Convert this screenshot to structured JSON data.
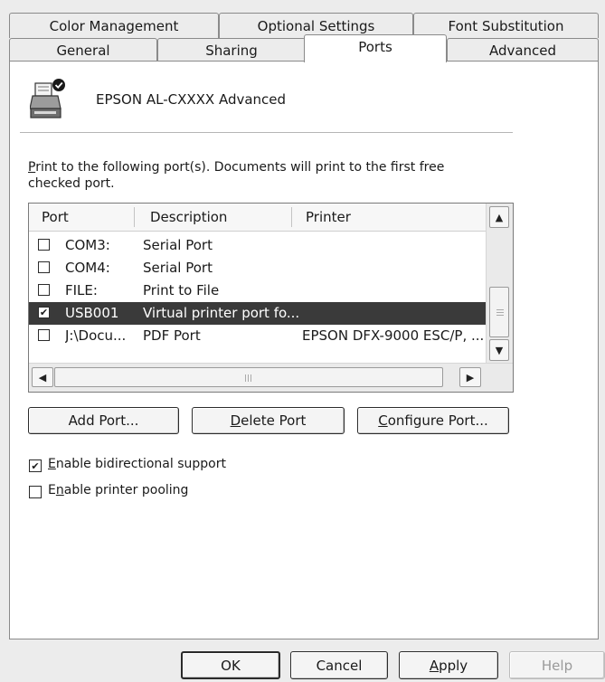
{
  "tabs": {
    "row_back": [
      "Color Management",
      "Optional Settings",
      "Font Substitution"
    ],
    "row_front": [
      "General",
      "Sharing",
      "Ports",
      "Advanced"
    ],
    "active": "Ports"
  },
  "printer": {
    "name": "EPSON AL-CXXXX Advanced",
    "icon": "printer-icon"
  },
  "instructions": {
    "line1_prefix": "P",
    "line1_rest": "rint to the following port(s). Documents will print to the first free",
    "line2": "checked port."
  },
  "ports_list": {
    "columns": [
      "Port",
      "Description",
      "Printer"
    ],
    "rows": [
      {
        "checked": false,
        "port": "COM3:",
        "description": "Serial Port",
        "printer": "",
        "selected": false
      },
      {
        "checked": false,
        "port": "COM4:",
        "description": "Serial Port",
        "printer": "",
        "selected": false
      },
      {
        "checked": false,
        "port": "FILE:",
        "description": "Print to File",
        "printer": "",
        "selected": false
      },
      {
        "checked": true,
        "port": "USB001",
        "description": "Virtual printer port fo...",
        "printer": "",
        "selected": true
      },
      {
        "checked": false,
        "port": "J:\\Docu...",
        "description": "PDF Port",
        "printer": "EPSON DFX-9000 ESC/P, ...",
        "selected": false
      }
    ]
  },
  "buttons": {
    "add_port": "Add Port...",
    "delete_port_u": "D",
    "delete_port_rest": "elete Port",
    "configure_port_u": "C",
    "configure_port_rest": "onfigure Port..."
  },
  "options": {
    "bidirectional_u": "E",
    "bidirectional_rest": "nable bidirectional support",
    "bidirectional_checked": true,
    "pooling_pre": "E",
    "pooling_u": "n",
    "pooling_rest": "able printer pooling",
    "pooling_checked": false
  },
  "footer": {
    "ok": "OK",
    "cancel": "Cancel",
    "apply_u": "A",
    "apply_rest": "pply",
    "help": "Help"
  }
}
